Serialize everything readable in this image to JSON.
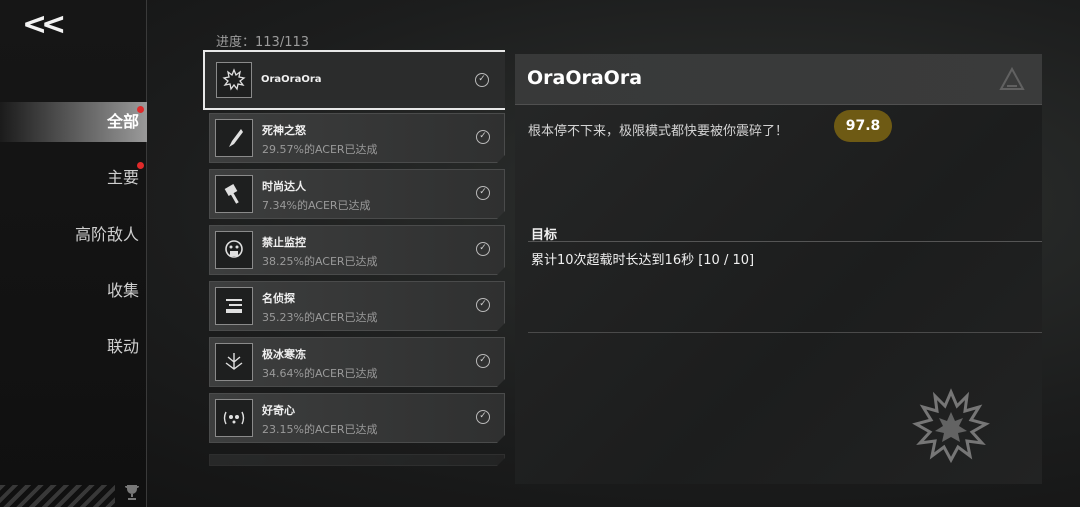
{
  "nav": {
    "back_label": "<<",
    "items": [
      {
        "label": "全部",
        "active": true,
        "badge": true
      },
      {
        "label": "主要",
        "active": false,
        "badge": true
      },
      {
        "label": "高阶敌人",
        "active": false,
        "badge": false
      },
      {
        "label": "收集",
        "active": false,
        "badge": false
      },
      {
        "label": "联动",
        "active": false,
        "badge": false
      }
    ]
  },
  "progress": "进度：113/113",
  "achievements": [
    {
      "name": "OraOraOra",
      "sub": "",
      "icon": "spiky-burst-icon",
      "selected": true
    },
    {
      "name": "死神之怒",
      "sub": "29.57%的ACER已达成",
      "icon": "blade-icon"
    },
    {
      "name": "时尚达人",
      "sub": "7.34%的ACER已达成",
      "icon": "hammer-icon"
    },
    {
      "name": "禁止监控",
      "sub": "38.25%的ACER已达成",
      "icon": "mask-icon"
    },
    {
      "name": "名侦探",
      "sub": "35.23%的ACER已达成",
      "icon": "document-icon"
    },
    {
      "name": "极冰寒冻",
      "sub": "34.64%的ACER已达成",
      "icon": "ice-icon"
    },
    {
      "name": "好奇心",
      "sub": "23.15%的ACER已达成",
      "icon": "curiosity-icon"
    }
  ],
  "detail": {
    "title": "OraOraOra",
    "description": "根本停不下来，极限模式都快要被你震碎了！",
    "score": "97.8",
    "goal_label": "目标",
    "goal_text": "累计10次超载时长达到16秒 [10 / 10]"
  },
  "colors": {
    "score_badge": "#6e5a14",
    "badge_dot": "#e02a2a",
    "selected_border": "#e8e8e8"
  }
}
